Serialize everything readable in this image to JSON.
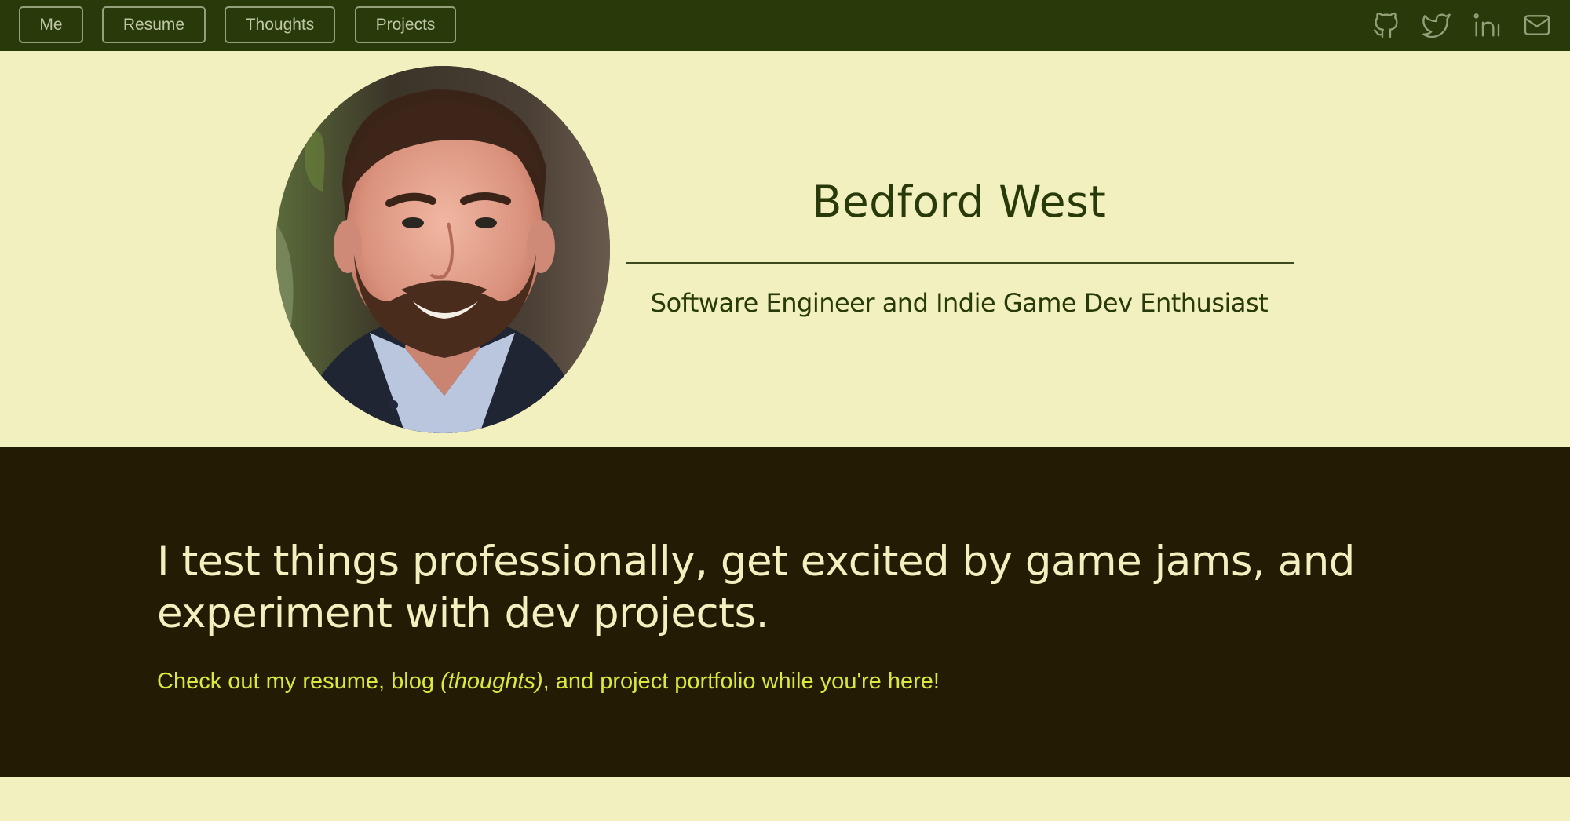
{
  "nav": {
    "items": [
      {
        "label": "Me"
      },
      {
        "label": "Resume"
      },
      {
        "label": "Thoughts"
      },
      {
        "label": "Projects"
      }
    ],
    "social": [
      "github-icon",
      "twitter-icon",
      "linkedin-icon",
      "mail-icon"
    ]
  },
  "hero": {
    "name": "Bedford West",
    "subtitle": "Software Engineer and Indie Game Dev Enthusiast"
  },
  "intro": {
    "headline": "I test things professionally, get excited by game jams, and experiment with dev projects.",
    "blurb": {
      "prefix": "Check out my ",
      "resume": "resume",
      "sep1": ", ",
      "blog": "blog",
      "sep2": " ",
      "thoughts": "(thoughts)",
      "sep3": ", and ",
      "portfolio": "project portfolio",
      "suffix": " while you're here!"
    }
  },
  "colors": {
    "nav_bg": "#283a0a",
    "hero_bg": "#f2f0bf",
    "intro_bg": "#231b04",
    "accent": "#d8ea3e",
    "heading": "#283a0a"
  }
}
